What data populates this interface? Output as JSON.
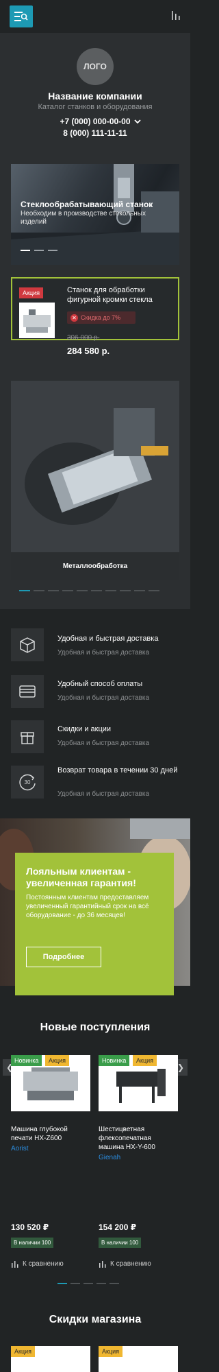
{
  "header": {
    "logo": "ЛОГО",
    "company": "Название компании",
    "tagline": "Каталог станков и оборудования",
    "phones": [
      "+7 (000) 000-00-00",
      "8 (000) 111-11-11"
    ]
  },
  "banner": {
    "title": "Стеклообрабатывающий станок",
    "subtitle": "Необходим в производстве стекольных изделий"
  },
  "promo": {
    "badge": "Акция",
    "title": "Станок для обработки фигурной кромки стекла",
    "discount": "Скидка до 7%",
    "old_price": "306 000 р.",
    "new_price": "284 580 р."
  },
  "category": {
    "caption": "Металлообработка"
  },
  "features": [
    {
      "title": "Удобная и быстрая доставка",
      "subtitle": "Удобная и быстрая доставка"
    },
    {
      "title": "Удобный способ оплаты",
      "subtitle": "Удобная и быстрая доставка"
    },
    {
      "title": "Скидки и акции",
      "subtitle": "Удобная и быстрая доставка"
    },
    {
      "title": "Возврат товара в течении 30 дней",
      "subtitle": "Удобная и быстрая доставка",
      "icon_text": "30"
    }
  ],
  "loyalty": {
    "title": "Лояльным клиентам - увеличенная гарантия!",
    "text": "Постоянным клиентам предоставляем увеличенный гарантийный срок на всё оборудование - до 36 месяцев!",
    "button": "Подробнее"
  },
  "new_arrivals": {
    "title": "Новые поступления",
    "products": [
      {
        "badge_new": "Новинка",
        "badge_sale": "Акция",
        "name": "Машина глубокой печати HX-Z600",
        "brand": "Aorist",
        "price": "130 520 ₽",
        "stock": "В наличии 100",
        "compare": "К сравнению"
      },
      {
        "badge_new": "Новинка",
        "badge_sale": "Акция",
        "name": "Шестицветная флексопечатная машина HX-Y-600",
        "brand": "Gienah",
        "price": "154 200 ₽",
        "stock": "В наличии 100",
        "compare": "К сравнению"
      }
    ]
  },
  "discounts": {
    "title": "Скидки магазина",
    "badges": [
      "Акция",
      "Акция"
    ]
  },
  "colors": {
    "accent": "#1d9ab4",
    "promo_border": "#a2c23a",
    "sale_badge": "#d0393f"
  }
}
